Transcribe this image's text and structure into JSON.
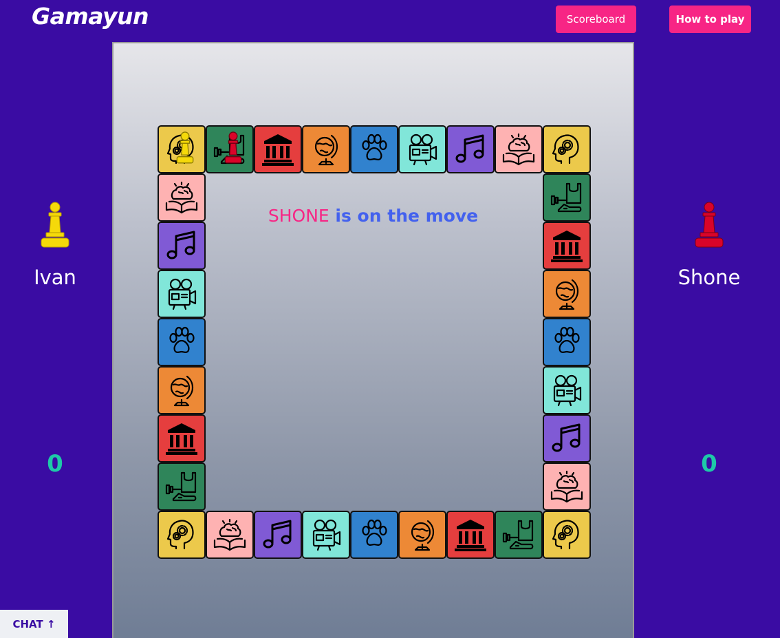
{
  "header": {
    "logo": "Gamayun",
    "scoreboard_label": "Scoreboard",
    "how_to_play_label": "How to play"
  },
  "players": [
    {
      "name": "Ivan",
      "score": "0",
      "color": "#f5d90a"
    },
    {
      "name": "Shone",
      "score": "0",
      "color": "#d90429"
    }
  ],
  "status": {
    "player": "SHONE",
    "text": " is on the move"
  },
  "chat_label": "CHAT ↑",
  "categories": {
    "mind": {
      "color": "#ecc94b",
      "icon": "head-gears-icon"
    },
    "sport": {
      "color": "#2f855a",
      "icon": "sport-gear-icon"
    },
    "history": {
      "color": "#e53e3e",
      "icon": "museum-icon"
    },
    "geography": {
      "color": "#ed8936",
      "icon": "globe-icon"
    },
    "animals": {
      "color": "#3182ce",
      "icon": "paw-icon"
    },
    "film": {
      "color": "#81e6d9",
      "icon": "movie-camera-icon"
    },
    "music": {
      "color": "#805ad5",
      "icon": "music-note-icon"
    },
    "science": {
      "color": "#feb2b2",
      "icon": "brain-book-icon"
    }
  },
  "board": {
    "top": [
      "mind",
      "sport",
      "history",
      "geography",
      "animals",
      "film",
      "music",
      "science",
      "mind"
    ],
    "right": [
      "sport",
      "history",
      "geography",
      "animals",
      "film",
      "music",
      "science"
    ],
    "bottom": [
      "mind",
      "science",
      "music",
      "film",
      "animals",
      "geography",
      "history",
      "sport",
      "mind"
    ],
    "left": [
      "science",
      "music",
      "film",
      "animals",
      "geography",
      "history",
      "sport"
    ]
  },
  "tokens": [
    {
      "player": "Ivan",
      "position": 0
    },
    {
      "player": "Shone",
      "position": 1
    }
  ]
}
